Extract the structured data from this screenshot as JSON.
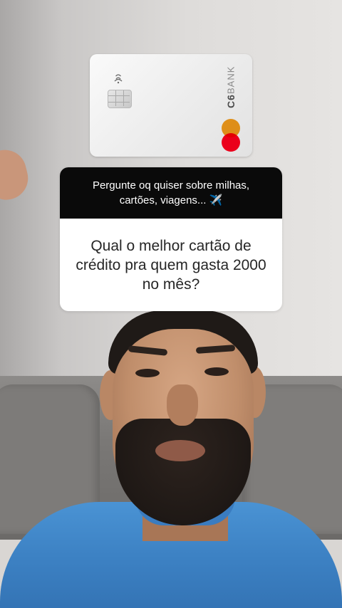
{
  "card": {
    "brand_strong": "C6",
    "brand_light": "BANK"
  },
  "question_sticker": {
    "prompt": "Pergunte oq quiser sobre milhas, cartões, viagens... ✈️",
    "answer": "Qual o melhor cartão de crédito pra quem gasta 2000 no mês?"
  },
  "colors": {
    "sticker_header": "#0a0a0a",
    "mastercard_red": "#eb001b",
    "mastercard_yellow": "#f79e1b",
    "shirt_blue": "#3d82c4"
  }
}
